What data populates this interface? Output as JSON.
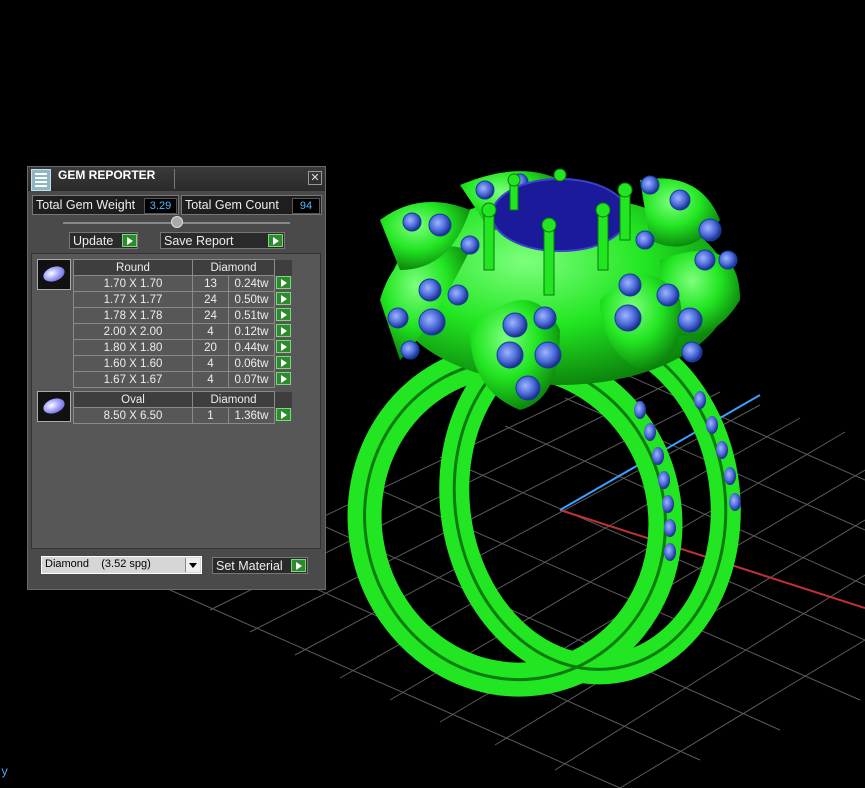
{
  "window": {
    "title": "GEM REPORTER"
  },
  "stats": {
    "total_weight_label": "Total Gem Weight",
    "total_weight_value": "3.29",
    "total_count_label": "Total Gem Count",
    "total_count_value": "94"
  },
  "buttons": {
    "update": "Update",
    "save_report": "Save Report",
    "set_material": "Set Material"
  },
  "groups": [
    {
      "shape": "Round",
      "material": "Diamond",
      "rows": [
        {
          "size": "1.70 X 1.70",
          "count": "13",
          "weight": "0.24tw"
        },
        {
          "size": "1.77 X 1.77",
          "count": "24",
          "weight": "0.50tw"
        },
        {
          "size": "1.78 X 1.78",
          "count": "24",
          "weight": "0.51tw"
        },
        {
          "size": "2.00 X 2.00",
          "count": "4",
          "weight": "0.12tw"
        },
        {
          "size": "1.80 X 1.80",
          "count": "20",
          "weight": "0.44tw"
        },
        {
          "size": "1.60 X 1.60",
          "count": "4",
          "weight": "0.06tw"
        },
        {
          "size": "1.67 X 1.67",
          "count": "4",
          "weight": "0.07tw"
        }
      ]
    },
    {
      "shape": "Oval",
      "material": "Diamond",
      "rows": [
        {
          "size": "8.50 X 6.50",
          "count": "1",
          "weight": "1.36tw"
        }
      ]
    }
  ],
  "material_select": {
    "value": "Diamond    (3.52 spg)"
  },
  "viewport": {
    "axis_label": "y"
  },
  "colors": {
    "ring": "#22e622",
    "gem_small": "#4a6ad8",
    "center_stone": "#1a1a9a",
    "grid": "#5a5a5a",
    "x_axis": "#c0303a",
    "z_axis": "#3aa0ff"
  }
}
